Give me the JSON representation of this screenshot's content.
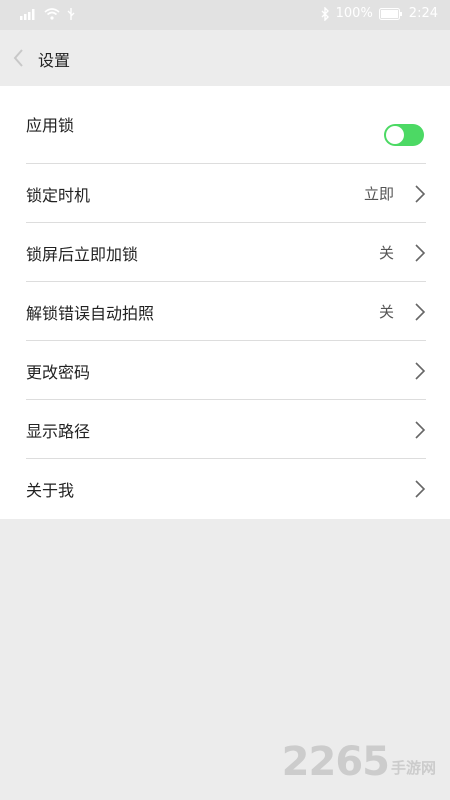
{
  "status_bar": {
    "battery_percent": "100%",
    "time": "2:24",
    "icons": [
      "signal-icon",
      "wifi-icon",
      "usb-icon",
      "bluetooth-icon",
      "battery-icon"
    ]
  },
  "app_bar": {
    "title": "设置",
    "back_icon": "chevron-left-icon"
  },
  "settings": {
    "app_lock": {
      "label": "应用锁",
      "enabled": true
    },
    "items": [
      {
        "label": "锁定时机",
        "value": "立即"
      },
      {
        "label": "锁屏后立即加锁",
        "value": "关"
      },
      {
        "label": "解锁错误自动拍照",
        "value": "关"
      },
      {
        "label": "更改密码",
        "value": ""
      },
      {
        "label": "显示路径",
        "value": ""
      },
      {
        "label": "关于我",
        "value": ""
      }
    ]
  },
  "watermark": {
    "number": "2265",
    "text": "手游网"
  },
  "colors": {
    "toggle_on": "#4cd964",
    "chevron": "#666666",
    "background": "#ececec",
    "card": "#ffffff"
  }
}
